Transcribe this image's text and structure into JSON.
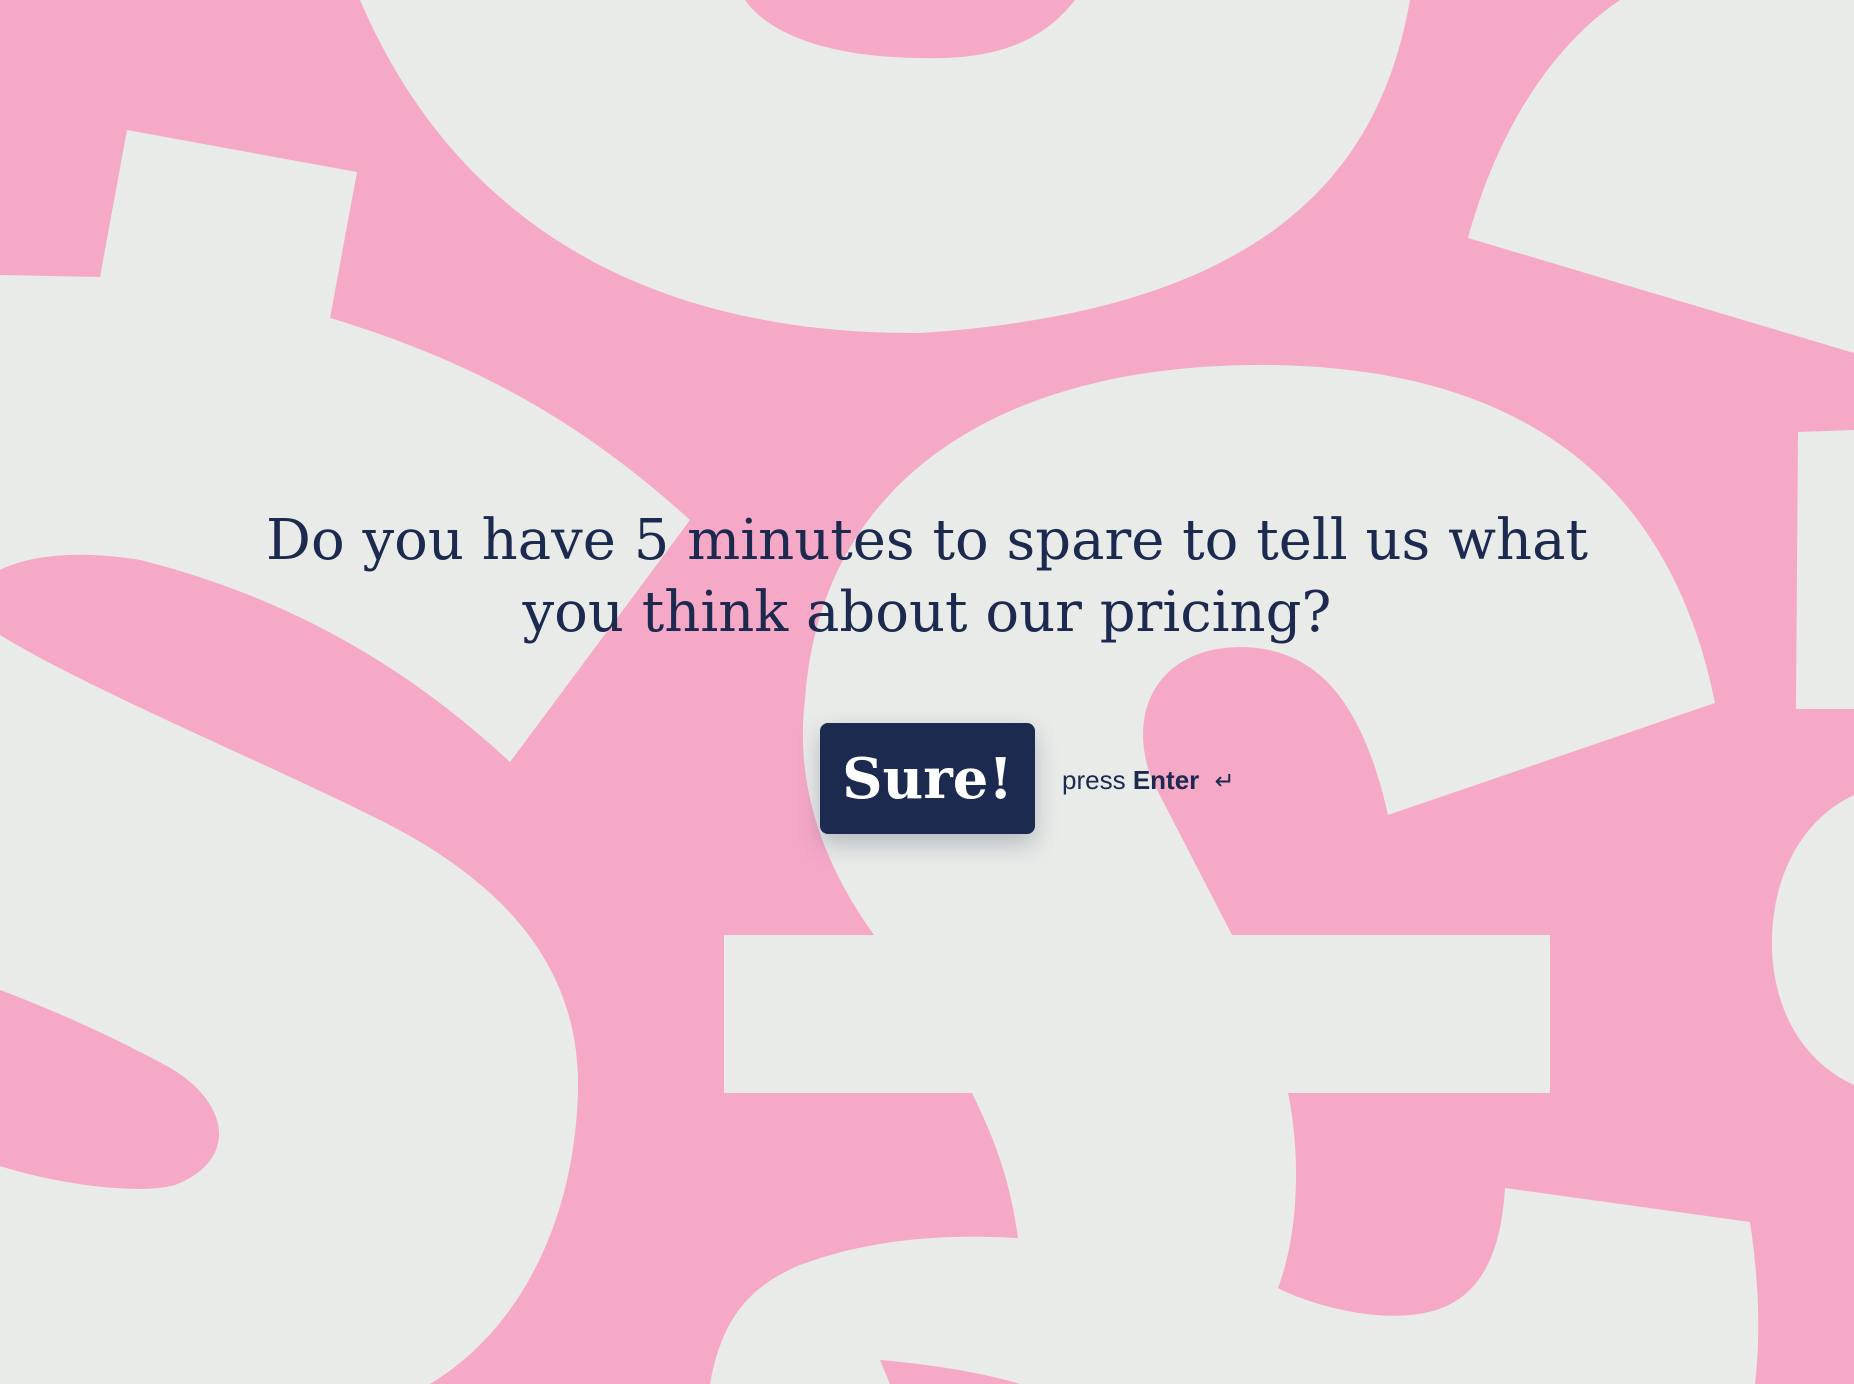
{
  "colors": {
    "background_pink": "#f6a9c7",
    "shape_gray": "#e9ebe8",
    "brand_navy": "#1b2a4e",
    "button_text": "#ffffff"
  },
  "question": {
    "text": "Do you have 5 minutes to spare to tell us what you think about our pricing?"
  },
  "cta": {
    "label": "Sure!"
  },
  "hint": {
    "prefix": "press",
    "key": "Enter",
    "icon": "enter-return-icon",
    "icon_glyph": "↵"
  }
}
